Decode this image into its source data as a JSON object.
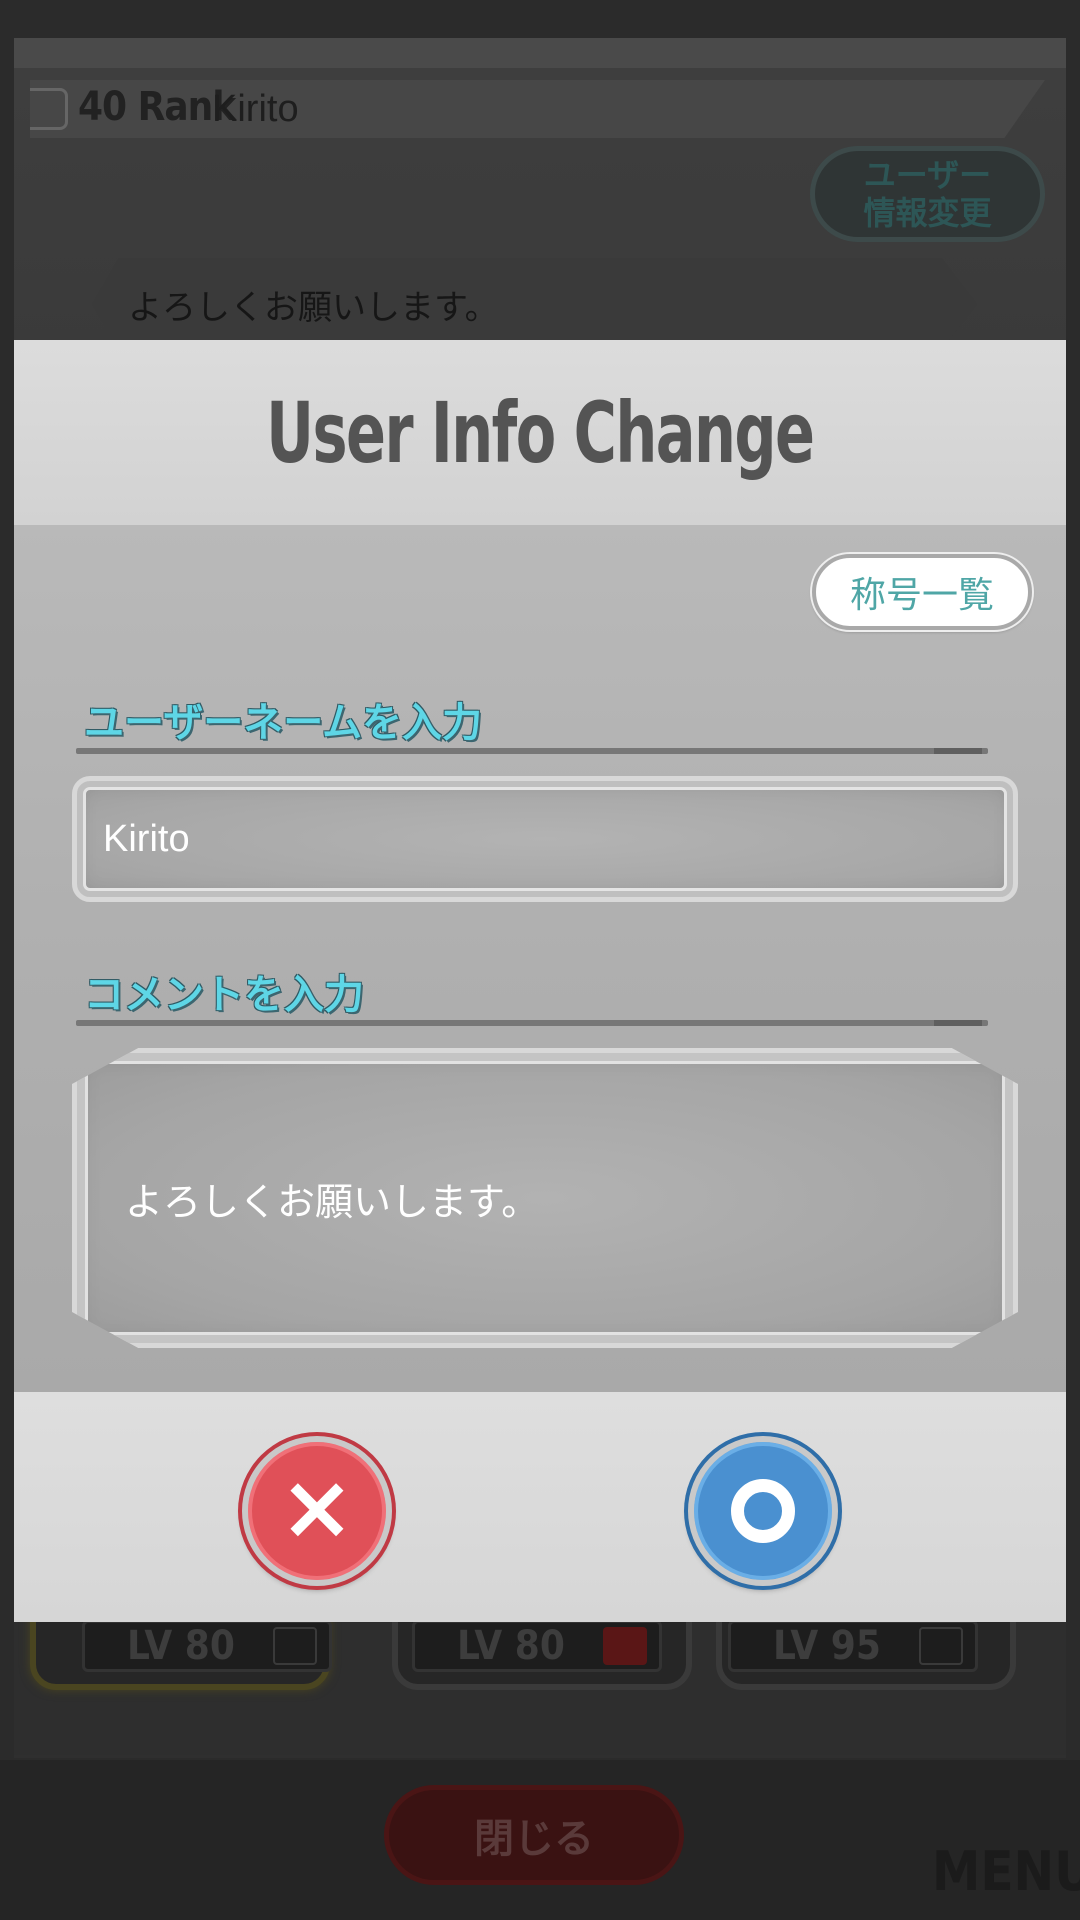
{
  "background": {
    "rank": "40 Rank",
    "player_name": "Kirito",
    "change_info_button": "ユーザー\n情報変更",
    "profile_comment": "よろしくお願いします。",
    "card_levels": [
      "LV  80",
      "LV  80",
      "LV  95"
    ],
    "close_button": "閉じる",
    "menu_label": "MENU"
  },
  "modal": {
    "title": "User Info Change",
    "title_list_button": "称号一覧",
    "username_label": "ユーザーネームを入力",
    "username_value": "Kirito",
    "comment_label": "コメントを入力",
    "comment_value": "よろしくお願いします。",
    "cancel_icon": "×",
    "confirm_icon": "circle-icon"
  },
  "colors": {
    "cancel": "#e05058",
    "confirm": "#4a90d0",
    "label_accent": "#5ed6e6",
    "title_list_text": "#4fa6a6"
  }
}
